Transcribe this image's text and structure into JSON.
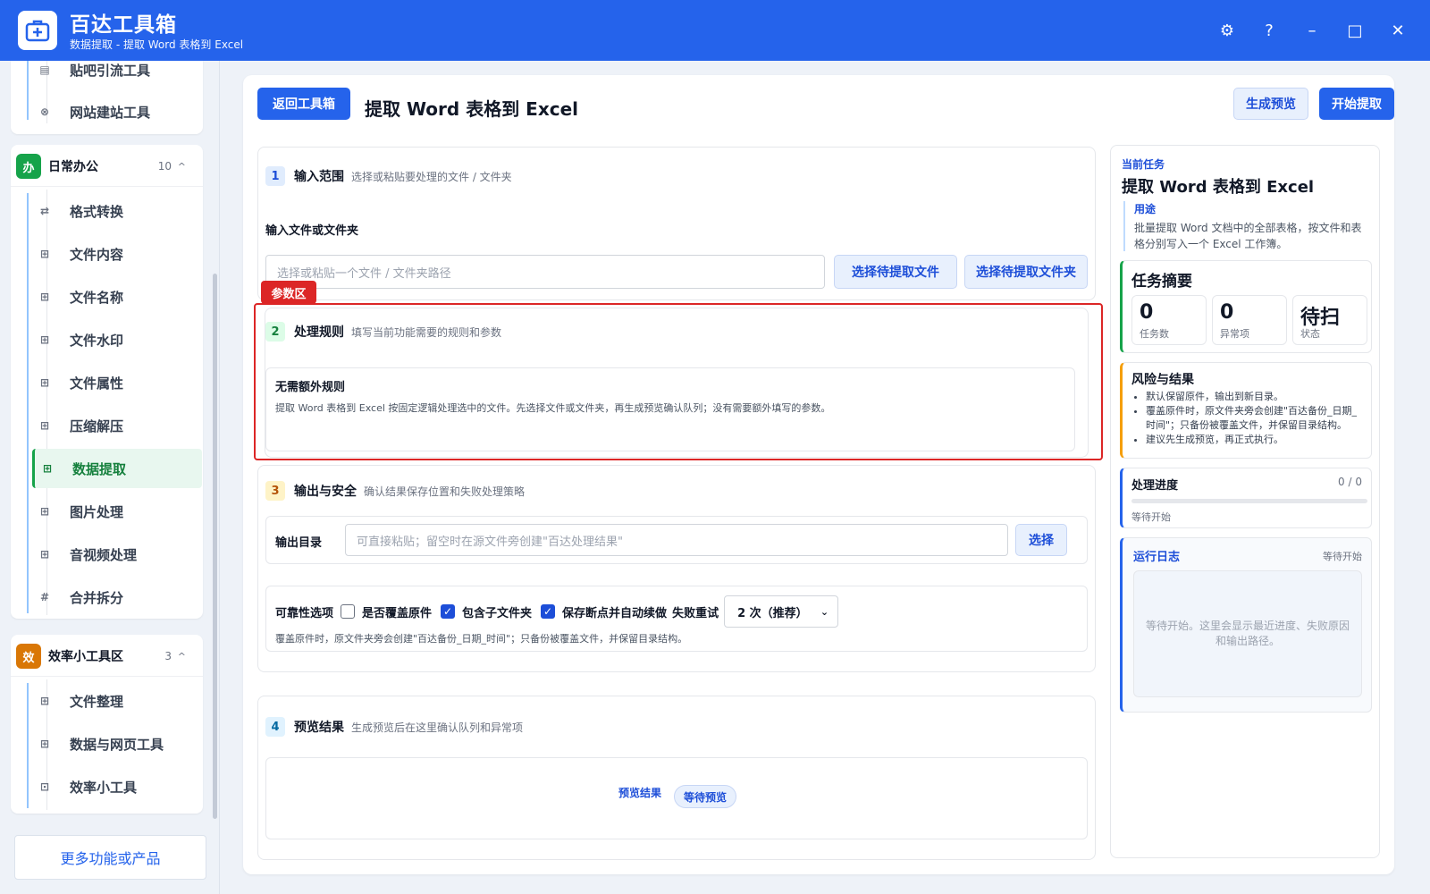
{
  "app": {
    "title": "百达工具箱",
    "subtitle": "数据提取 - 提取 Word 表格到 Excel"
  },
  "window": {
    "settings": "⚙",
    "help": "?",
    "minimize": "–",
    "maximize": "□",
    "close": "✕"
  },
  "sidebar": {
    "top_items": [
      {
        "label": "贴吧引流工具",
        "icon": "▤"
      },
      {
        "label": "网站建站工具",
        "icon": "⊗"
      }
    ],
    "group_office": {
      "badge": "办",
      "badge_color": "#16a34a",
      "name": "日常办公",
      "count": "10",
      "caret": "^",
      "items": [
        {
          "label": "格式转换",
          "icon": "⇄"
        },
        {
          "label": "文件内容",
          "icon": "⊞"
        },
        {
          "label": "文件名称",
          "icon": "⊞"
        },
        {
          "label": "文件水印",
          "icon": "⊞"
        },
        {
          "label": "文件属性",
          "icon": "⊞"
        },
        {
          "label": "压缩解压",
          "icon": "⊞"
        },
        {
          "label": "数据提取",
          "icon": "⊞"
        },
        {
          "label": "图片处理",
          "icon": "⊞"
        },
        {
          "label": "音视频处理",
          "icon": "⊞"
        },
        {
          "label": "合并拆分",
          "icon": "#"
        }
      ]
    },
    "group_efficiency": {
      "badge": "效",
      "badge_color": "#d97706",
      "name": "效率小工具区",
      "count": "3",
      "caret": "^",
      "items": [
        {
          "label": "文件整理",
          "icon": "⊞"
        },
        {
          "label": "数据与网页工具",
          "icon": "⊞"
        },
        {
          "label": "效率小工具",
          "icon": "⊡"
        }
      ]
    },
    "more": "更多功能或产品"
  },
  "toolbar": {
    "back": "返回工具箱",
    "title": "提取 Word 表格到 Excel",
    "preview": "生成预览",
    "start": "开始提取"
  },
  "sections": {
    "input": {
      "num": "1",
      "title": "输入范围",
      "desc": "选择或粘贴要处理的文件 / 文件夹",
      "label": "输入文件或文件夹",
      "placeholder": "选择或粘贴一个文件 / 文件夹路径",
      "btn_file": "选择待提取文件",
      "btn_folder": "选择待提取文件夹"
    },
    "highlight_tag": "参数区",
    "rules": {
      "num": "2",
      "title": "处理规则",
      "desc": "填写当前功能需要的规则和参数",
      "box_title": "无需额外规则",
      "box_text": "提取 Word 表格到 Excel 按固定逻辑处理选中的文件。先选择文件或文件夹，再生成预览确认队列；没有需要额外填写的参数。"
    },
    "output": {
      "num": "3",
      "title": "输出与安全",
      "desc": "确认结果保存位置和失败处理策略",
      "dir_label": "输出目录",
      "dir_placeholder": "可直接粘贴；留空时在源文件旁创建\"百达处理结果\"",
      "choose": "选择",
      "rel_label": "可靠性选项",
      "opt_overwrite": "是否覆盖原件",
      "opt_subfolders": "包含子文件夹",
      "opt_resume": "保存断点并自动续做",
      "retry_label": "失败重试",
      "retry_value": "2 次（推荐）",
      "note": "覆盖原件时，原文件夹旁会创建\"百达备份_日期_时间\"；只备份被覆盖文件，并保留目录结构。"
    },
    "preview": {
      "num": "4",
      "title": "预览结果",
      "desc": "生成预览后在这里确认队列和异常项",
      "label": "预览结果",
      "status": "等待预览"
    }
  },
  "right": {
    "current_label": "当前任务",
    "task_title": "提取 Word 表格到 Excel",
    "usage_label": "用途",
    "usage_text": "批量提取 Word 文档中的全部表格，按文件和表格分别写入一个 Excel 工作簿。",
    "summary_title": "任务摘要",
    "stats": [
      {
        "value": "0",
        "label": "任务数"
      },
      {
        "value": "0",
        "label": "异常项"
      },
      {
        "value": "待扫",
        "label": "状态"
      }
    ],
    "risk_title": "风险与结果",
    "risks": [
      "默认保留原件，输出到新目录。",
      "覆盖原件时，原文件夹旁会创建\"百达备份_日期_时间\"；只备份被覆盖文件，并保留目录结构。",
      "建议先生成预览，再正式执行。"
    ],
    "progress_title": "处理进度",
    "progress_count": "0 / 0",
    "progress_value": 0,
    "progress_status": "等待开始",
    "log_title": "运行日志",
    "log_status": "等待开始",
    "log_text": "等待开始。这里会显示最近进度、失败原因和输出路径。"
  }
}
